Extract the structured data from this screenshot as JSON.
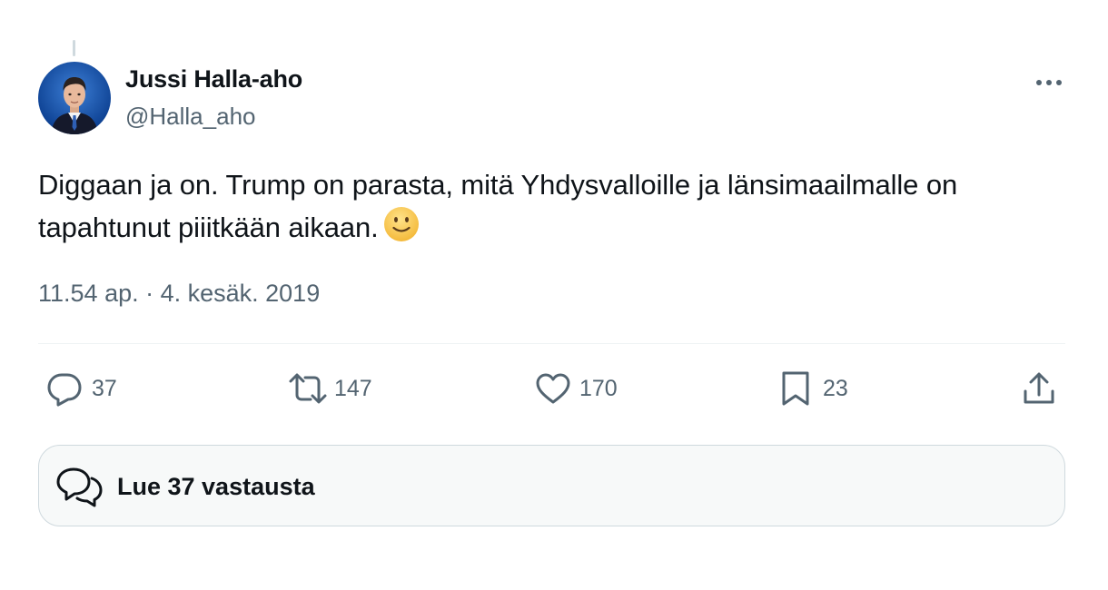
{
  "tweet": {
    "author": {
      "name": "Jussi Halla-aho",
      "handle": "@Halla_aho"
    },
    "text": "Diggaan ja on. Trump on parasta, mitä Yhdysvalloille ja länsimaailmalle on tapahtunut piiitkään aikaan.",
    "timestamp": "11.54 ap. · 4. kesäk. 2019",
    "actions": {
      "replies": "37",
      "retweets": "147",
      "likes": "170",
      "bookmarks": "23"
    },
    "read_replies_label": "Lue 37 vastausta"
  },
  "icons": {
    "more": "more-horizontal-icon",
    "reply": "reply-icon",
    "retweet": "retweet-icon",
    "like": "heart-icon",
    "bookmark": "bookmark-icon",
    "share": "share-icon",
    "replies_bubble": "speech-bubbles-icon",
    "emoji": "slightly-smiling-face-emoji"
  },
  "colors": {
    "text_primary": "#0f1419",
    "text_secondary": "#536471",
    "border": "#cfd9de",
    "box_background": "#f7f9f9"
  }
}
